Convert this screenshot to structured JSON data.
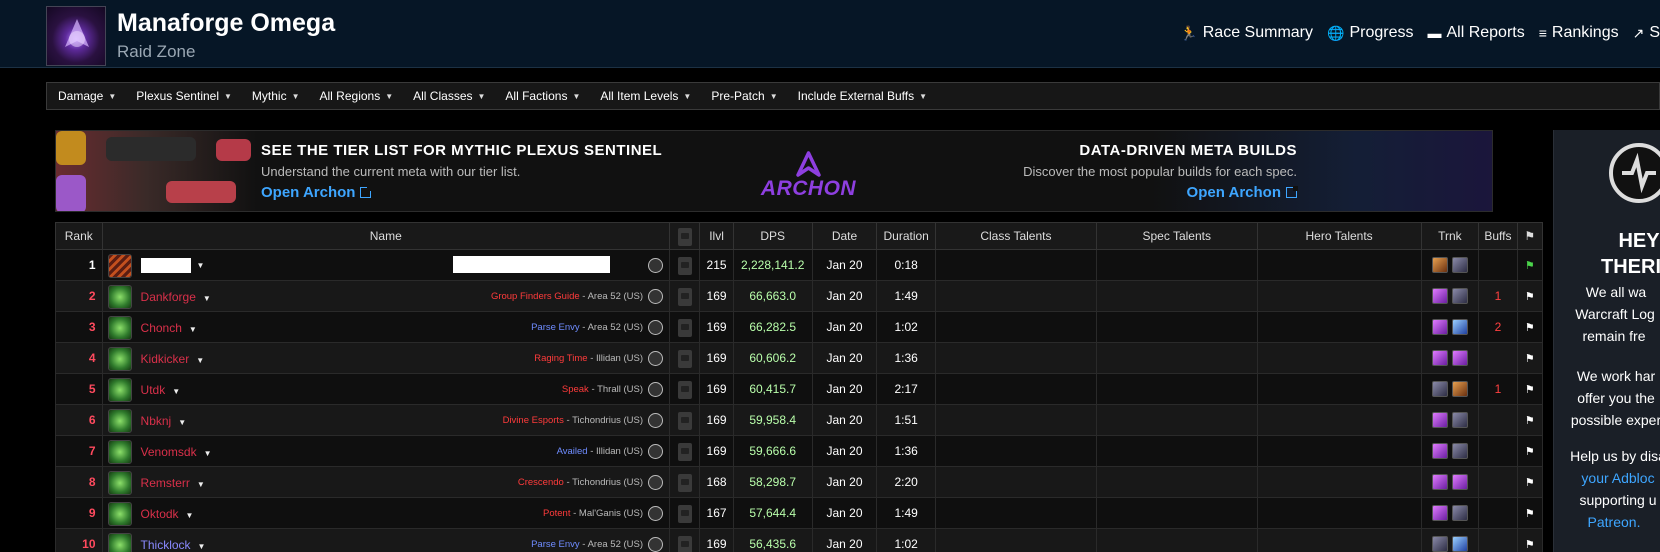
{
  "header": {
    "title": "Manaforge Omega",
    "subtitle": "Raid Zone",
    "nav": [
      {
        "icon": "runner-icon",
        "glyph": "🏃",
        "label": "Race Summary"
      },
      {
        "icon": "globe-icon",
        "glyph": "🌐",
        "label": "Progress"
      },
      {
        "icon": "reports-icon",
        "glyph": "▬",
        "label": "All Reports"
      },
      {
        "icon": "rankings-icon",
        "glyph": "≡",
        "label": "Rankings"
      },
      {
        "icon": "trend-icon",
        "glyph": "↗",
        "label": "S"
      }
    ]
  },
  "filters": [
    "Damage",
    "Plexus Sentinel",
    "Mythic",
    "All Regions",
    "All Classes",
    "All Factions",
    "All Item Levels",
    "Pre-Patch",
    "Include External Buffs"
  ],
  "banner": {
    "left_heading": "SEE THE TIER LIST FOR MYTHIC PLEXUS SENTINEL",
    "left_text": "Understand the current meta with our tier list.",
    "left_link": "Open Archon",
    "brand": "ARCHON",
    "right_heading": "DATA-DRIVEN META BUILDS",
    "right_text": "Discover the most popular builds for each spec.",
    "right_link": "Open Archon"
  },
  "side_ad": {
    "lines": [
      "HEY",
      "THERI",
      "We all wa",
      "Warcraft Log",
      "remain fre",
      "We work har",
      "offer you the",
      "possible exper",
      "Help us by disa",
      "your Adbloc",
      "supporting u",
      "Patreon."
    ]
  },
  "table": {
    "headers": {
      "rank": "Rank",
      "name": "Name",
      "video": "You Tube",
      "ilvl": "Ilvl",
      "dps": "DPS",
      "date": "Date",
      "duration": "Duration",
      "class_talents": "Class Talents",
      "spec_talents": "Spec Talents",
      "hero_talents": "Hero Talents",
      "trinkets": "Trnk",
      "buffs": "Buffs",
      "flag": "⚑"
    },
    "rows": [
      {
        "rank": "1",
        "name": "",
        "guild": "",
        "server": "",
        "ilvl": "215",
        "dps": "2,228,141.2",
        "date": "Jan 20",
        "duration": "0:18",
        "buffs": "",
        "redacted": true
      },
      {
        "rank": "2",
        "name": "Dankforge",
        "guild": "Group Finders Guide",
        "guild_color": "#ff3b3b",
        "server": " - Area 52 (US)",
        "ilvl": "169",
        "dps": "66,663.0",
        "date": "Jan 20",
        "duration": "1:49",
        "buffs": "1"
      },
      {
        "rank": "3",
        "name": "Chonch",
        "guild": "Parse Envy",
        "guild_color": "#6f8cff",
        "server": " - Area 52 (US)",
        "ilvl": "169",
        "dps": "66,282.5",
        "date": "Jan 20",
        "duration": "1:02",
        "buffs": "2"
      },
      {
        "rank": "4",
        "name": "Kidkicker",
        "guild": "Raging Time",
        "guild_color": "#ff3b3b",
        "server": " - Illidan (US)",
        "ilvl": "169",
        "dps": "60,606.2",
        "date": "Jan 20",
        "duration": "1:36",
        "buffs": ""
      },
      {
        "rank": "5",
        "name": "Utdk",
        "guild": "Speak",
        "guild_color": "#ff3b3b",
        "server": " - Thrall (US)",
        "ilvl": "169",
        "dps": "60,415.7",
        "date": "Jan 20",
        "duration": "2:17",
        "buffs": "1"
      },
      {
        "rank": "6",
        "name": "Nbknj",
        "guild": "Divine Esports",
        "guild_color": "#ff3b3b",
        "server": " - Tichondrius (US)",
        "ilvl": "169",
        "dps": "59,958.4",
        "date": "Jan 20",
        "duration": "1:51",
        "buffs": ""
      },
      {
        "rank": "7",
        "name": "Venomsdk",
        "guild": "Availed",
        "guild_color": "#6f8cff",
        "server": " - Illidan (US)",
        "ilvl": "169",
        "dps": "59,666.6",
        "date": "Jan 20",
        "duration": "1:36",
        "buffs": ""
      },
      {
        "rank": "8",
        "name": "Remsterr",
        "guild": "Crescendo",
        "guild_color": "#ff3b3b",
        "server": " - Tichondrius (US)",
        "ilvl": "168",
        "dps": "58,298.7",
        "date": "Jan 20",
        "duration": "2:20",
        "buffs": ""
      },
      {
        "rank": "9",
        "name": "Oktodk",
        "guild": "Potent",
        "guild_color": "#ff3b3b",
        "server": " - Mal'Ganis (US)",
        "ilvl": "167",
        "dps": "57,644.4",
        "date": "Jan 20",
        "duration": "1:49",
        "buffs": ""
      },
      {
        "rank": "10",
        "name": "Thicklock",
        "guild": "Parse Envy",
        "guild_color": "#6f8cff",
        "server": " - Area 52 (US)",
        "ilvl": "169",
        "dps": "56,435.6",
        "date": "Jan 20",
        "duration": "1:02",
        "buffs": ""
      }
    ]
  },
  "colors": {
    "rank_red": "#ff4a5e",
    "name_red": "#d9304a",
    "name_purple": "#8a8aff",
    "dps_green": "#b9ffab",
    "link_blue": "#3ea6ff"
  }
}
